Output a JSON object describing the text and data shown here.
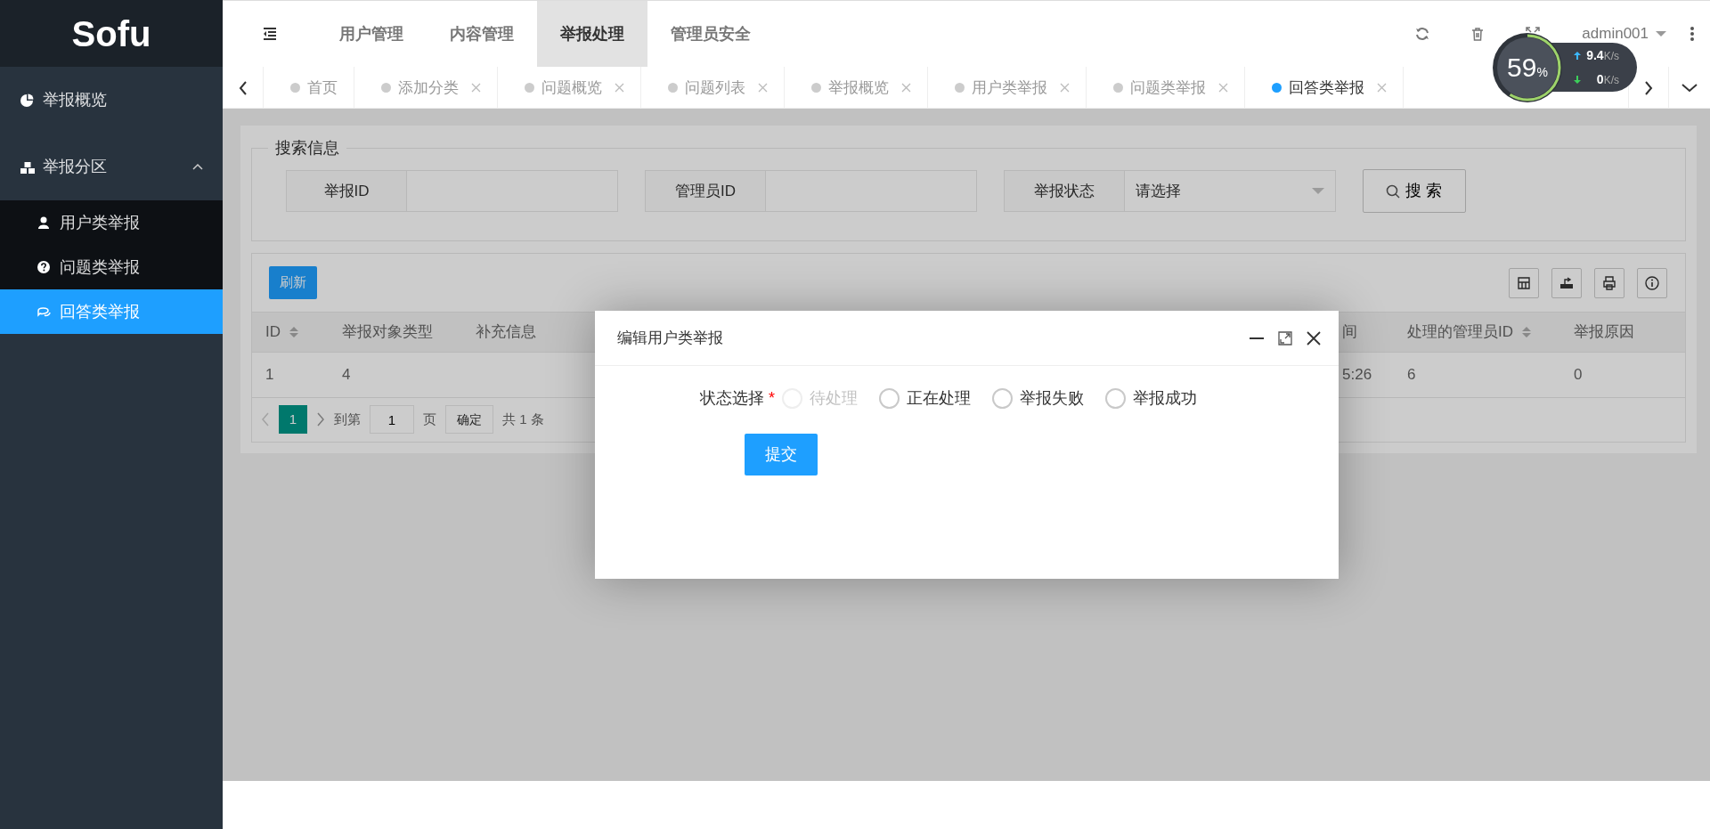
{
  "logo": "Sofu",
  "sidebar": {
    "items": [
      {
        "label": "举报概览",
        "selected": false,
        "expanded": false
      },
      {
        "label": "举报分区",
        "selected": false,
        "expanded": true,
        "children": [
          {
            "label": "用户类举报",
            "selected": false
          },
          {
            "label": "问题类举报",
            "selected": false
          },
          {
            "label": "回答类举报",
            "selected": true
          }
        ]
      }
    ]
  },
  "top_nav": [
    {
      "label": "用户管理",
      "selected": false
    },
    {
      "label": "内容管理",
      "selected": false
    },
    {
      "label": "举报处理",
      "selected": true
    },
    {
      "label": "管理员安全",
      "selected": false
    }
  ],
  "user": "admin001",
  "speed_widget": {
    "percent": "59",
    "percent_unit": "%",
    "level": 0.59,
    "upload": "9.4",
    "upload_unit": "K/s",
    "download": "0",
    "download_unit": "K/s"
  },
  "tabs": [
    {
      "label": "首页",
      "closable": false,
      "selected": false
    },
    {
      "label": "添加分类",
      "closable": true,
      "selected": false
    },
    {
      "label": "问题概览",
      "closable": true,
      "selected": false
    },
    {
      "label": "问题列表",
      "closable": true,
      "selected": false
    },
    {
      "label": "举报概览",
      "closable": true,
      "selected": false
    },
    {
      "label": "用户类举报",
      "closable": true,
      "selected": false
    },
    {
      "label": "问题类举报",
      "closable": true,
      "selected": false
    },
    {
      "label": "回答类举报",
      "closable": true,
      "selected": true
    }
  ],
  "search": {
    "legend": "搜索信息",
    "fields": [
      {
        "label": "举报ID"
      },
      {
        "label": "管理员ID"
      }
    ],
    "select": {
      "label": "举报状态",
      "value": "请选择"
    },
    "button": "搜 索"
  },
  "table": {
    "refresh_button": "刷新",
    "columns": [
      {
        "label": "ID",
        "sortable": true
      },
      {
        "label": "举报对象类型",
        "sortable": false
      },
      {
        "label": "补充信息",
        "sortable": false
      },
      {
        "label": "间",
        "sortable": false
      },
      {
        "label": "处理的管理员ID",
        "sortable": true
      },
      {
        "label": "举报原因",
        "sortable": false
      }
    ],
    "rows": [
      {
        "cells": [
          "1",
          "4",
          null,
          "5:26",
          "6",
          "0"
        ]
      }
    ]
  },
  "pager": {
    "page": "1",
    "goto_label": "到第",
    "goto_value": "1",
    "page_label": "页",
    "confirm": "确定",
    "total": "共 1 条"
  },
  "dialog": {
    "title": "编辑用户类举报",
    "field_label": "状态选择",
    "required_mark": "*",
    "options": [
      {
        "label": "待处理",
        "selected": false,
        "disabled": true
      },
      {
        "label": "正在处理",
        "selected": false,
        "disabled": false
      },
      {
        "label": "举报失败",
        "selected": false,
        "disabled": false
      },
      {
        "label": "举报成功",
        "selected": false,
        "disabled": false
      }
    ],
    "submit": "提交"
  }
}
